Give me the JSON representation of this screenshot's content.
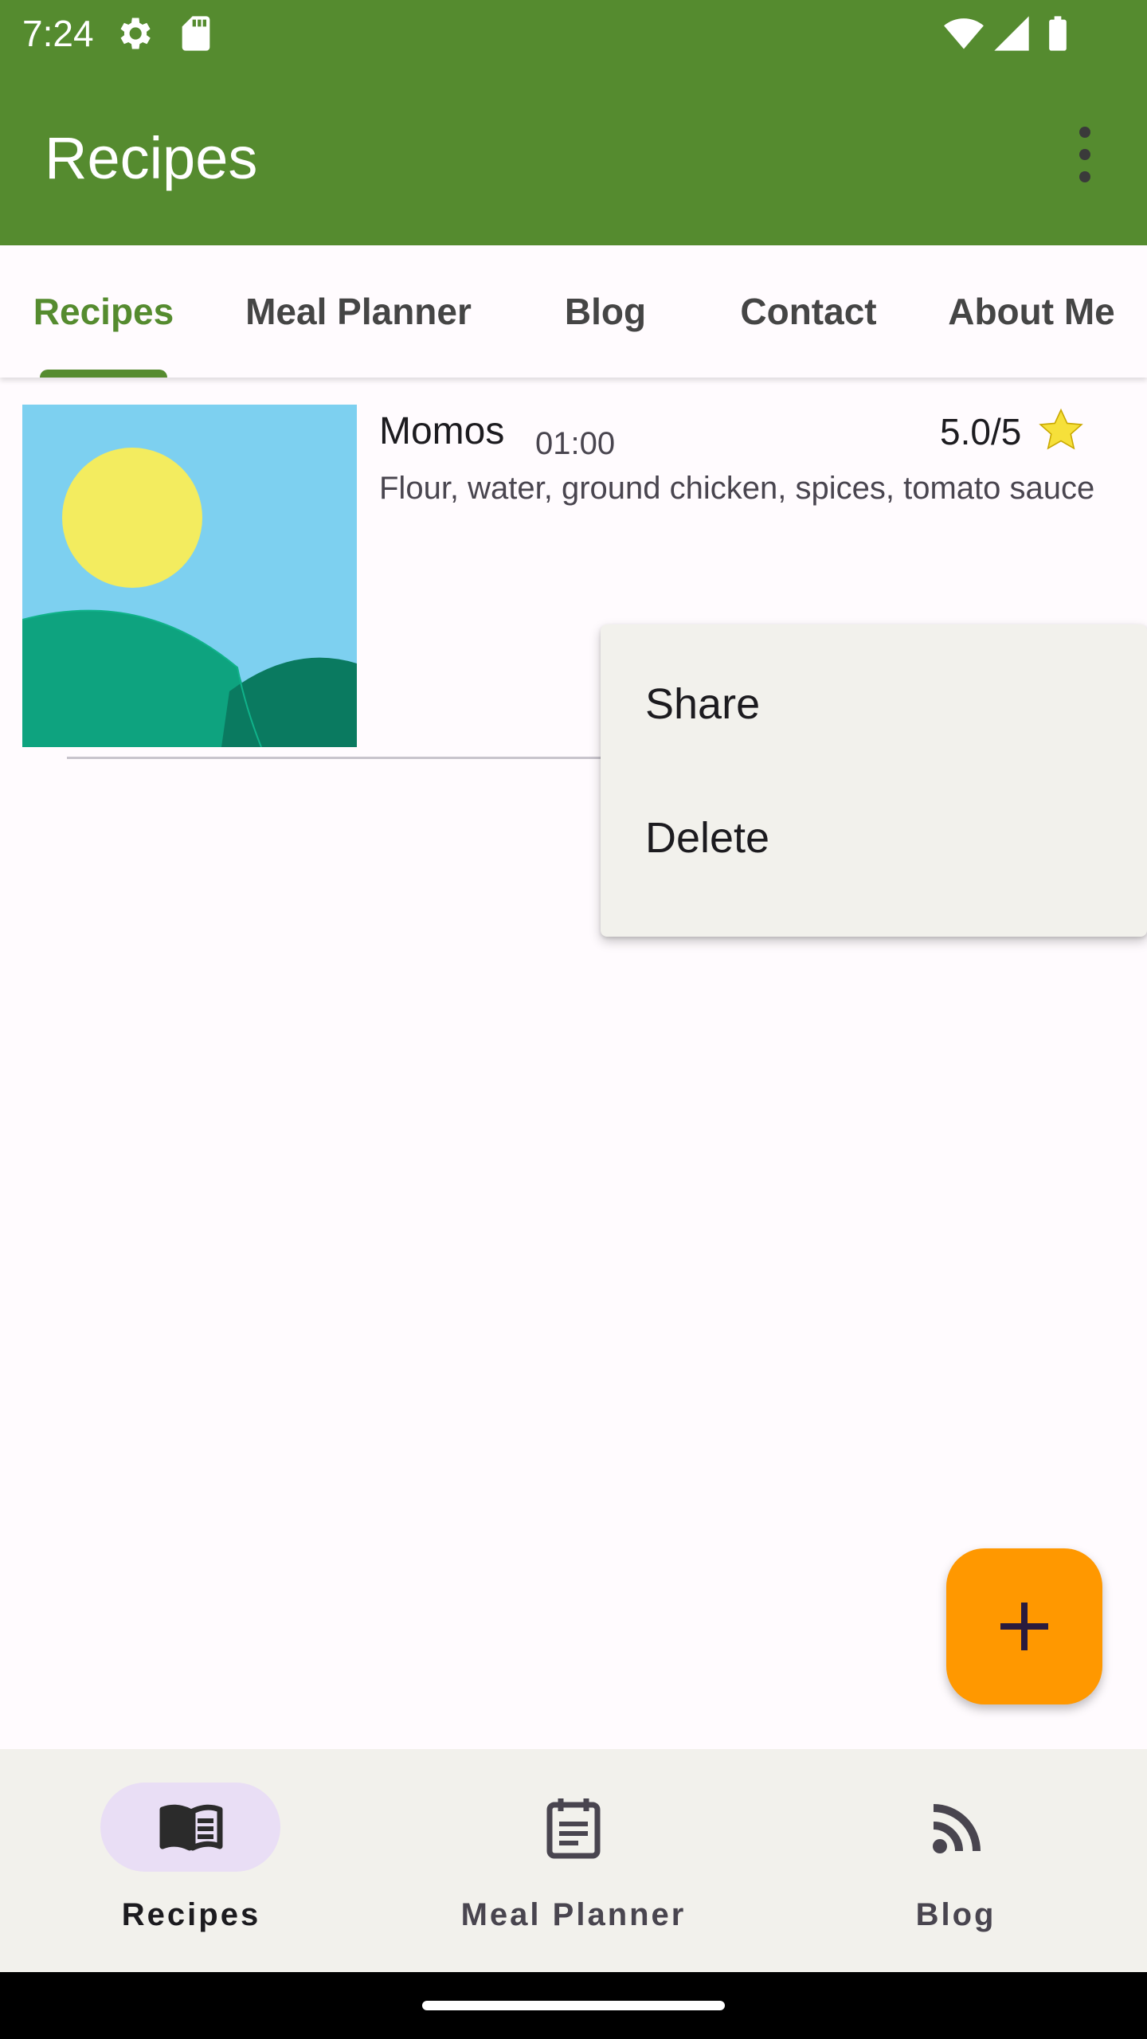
{
  "status_bar": {
    "time": "7:24",
    "icons": [
      "settings-gear-icon",
      "sd-card-icon",
      "wifi-icon",
      "cell-signal-icon",
      "battery-icon"
    ]
  },
  "app_bar": {
    "title": "Recipes",
    "overflow_icon": "more-vert-icon"
  },
  "tabs": [
    {
      "label": "Recipes",
      "active": true
    },
    {
      "label": "Meal Planner",
      "active": false
    },
    {
      "label": "Blog",
      "active": false
    },
    {
      "label": "Contact",
      "active": false
    },
    {
      "label": "About Me",
      "active": false
    }
  ],
  "recipes": [
    {
      "name": "Momos",
      "time": "01:00",
      "rating": "5.0/5",
      "ingredients": "Flour, water, ground chicken, spices, tomato sauce",
      "image": "placeholder-landscape-image"
    }
  ],
  "context_menu": {
    "items": [
      "Share",
      "Delete"
    ]
  },
  "fab": {
    "icon": "add-icon"
  },
  "bottom_nav": [
    {
      "label": "Recipes",
      "icon": "book-icon",
      "active": true
    },
    {
      "label": "Meal Planner",
      "icon": "calendar-note-icon",
      "active": false
    },
    {
      "label": "Blog",
      "icon": "rss-feed-icon",
      "active": false
    }
  ],
  "colors": {
    "primary": "#558b2f",
    "fab": "#ff9800",
    "nav_pill": "#e9def5",
    "menu_bg": "#f2f1ec"
  }
}
